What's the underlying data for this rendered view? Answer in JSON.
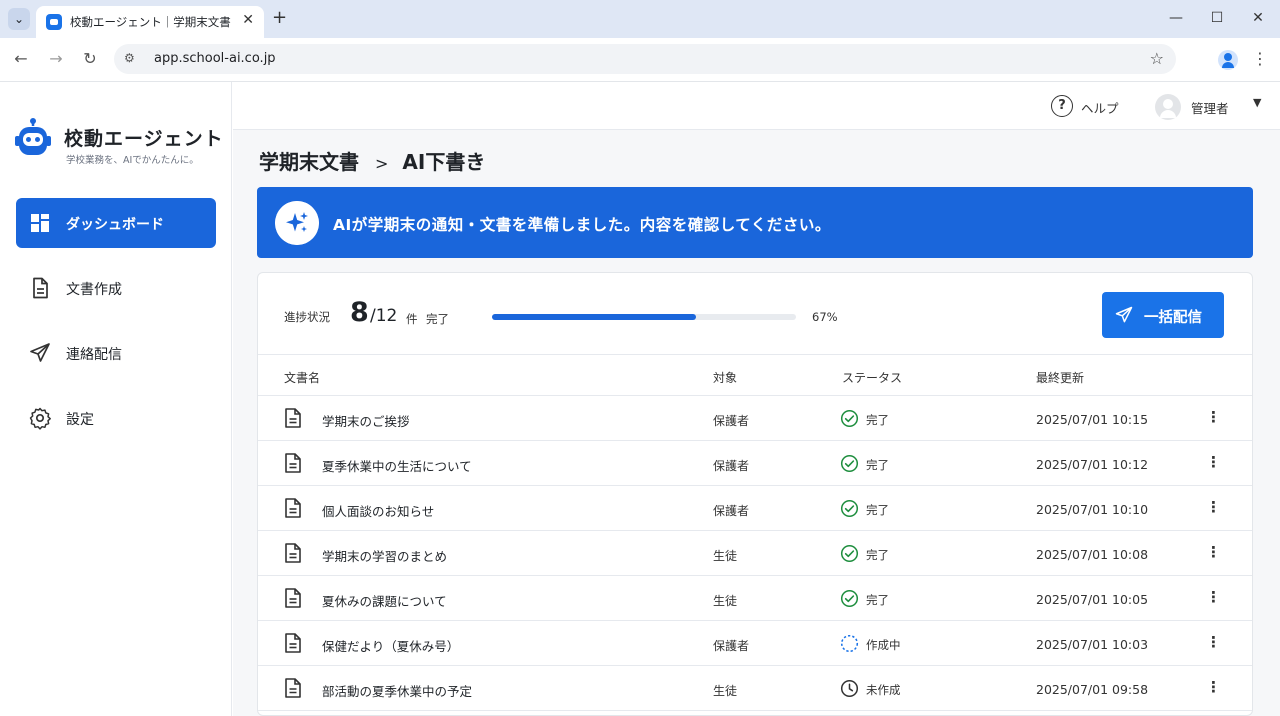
{
  "browser": {
    "tab_title": "校動エージェント｜学期末文書 > AI下書き",
    "url": "app.school-ai.co.jp"
  },
  "sidebar": {
    "brand": "校動エージェント",
    "tagline": "学校業務を、AIでかんたんに。",
    "items": [
      {
        "label": "ダッシュボード",
        "icon": "dashboard-icon",
        "active": true
      },
      {
        "label": "文書作成",
        "icon": "document-icon",
        "active": false
      },
      {
        "label": "連絡配信",
        "icon": "send-icon",
        "active": false
      },
      {
        "label": "設定",
        "icon": "gear-icon",
        "active": false
      }
    ]
  },
  "header": {
    "help_label": "ヘルプ",
    "user_label": "管理者"
  },
  "breadcrumb": {
    "parent": "学期末文書",
    "separator": ">",
    "current": "AI下書き"
  },
  "banner": {
    "text": "AIが学期末の通知・文書を準備しました。内容を確認してください。"
  },
  "progress": {
    "label": "進捗状況",
    "done": "8",
    "total": "/12",
    "unit": "件",
    "status": "完了",
    "percent_text": "67%",
    "fraction": 0.67
  },
  "actions": {
    "bulk_send_label": "一括配信"
  },
  "table": {
    "headers": {
      "name": "文書名",
      "target": "対象",
      "status": "ステータス",
      "updated": "最終更新"
    },
    "rows": [
      {
        "name": "学期末のご挨拶",
        "target": "保護者",
        "status": "完了",
        "status_kind": "done",
        "updated": "2025/07/01 10:15"
      },
      {
        "name": "夏季休業中の生活について",
        "target": "保護者",
        "status": "完了",
        "status_kind": "done",
        "updated": "2025/07/01 10:12"
      },
      {
        "name": "個人面談のお知らせ",
        "target": "保護者",
        "status": "完了",
        "status_kind": "done",
        "updated": "2025/07/01 10:10"
      },
      {
        "name": "学期末の学習のまとめ",
        "target": "生徒",
        "status": "完了",
        "status_kind": "done",
        "updated": "2025/07/01 10:08"
      },
      {
        "name": "夏休みの課題について",
        "target": "生徒",
        "status": "完了",
        "status_kind": "done",
        "updated": "2025/07/01 10:05"
      },
      {
        "name": "保健だより（夏休み号）",
        "target": "保護者",
        "status": "作成中",
        "status_kind": "in-progress",
        "updated": "2025/07/01 10:03"
      },
      {
        "name": "部活動の夏季休業中の予定",
        "target": "生徒",
        "status": "未作成",
        "status_kind": "pending",
        "updated": "2025/07/01 09:58"
      }
    ]
  },
  "colors": {
    "accent": "#1a66db",
    "done": "#1e8e3e",
    "in_progress": "#1a73e8",
    "pending": "#333333"
  }
}
